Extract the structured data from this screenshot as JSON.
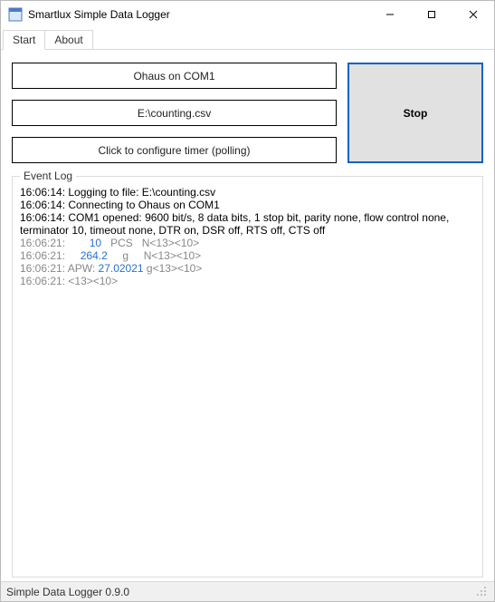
{
  "window": {
    "title": "Smartlux Simple Data Logger"
  },
  "tabs": {
    "start": "Start",
    "about": "About"
  },
  "buttons": {
    "device": "Ohaus on COM1",
    "file": "E:\\counting.csv",
    "timer": "Click to configure timer (polling)",
    "stop": "Stop"
  },
  "log": {
    "legend": "Event Log",
    "lines": [
      {
        "t": "16:06:14:",
        "rest": " Logging to file: E:\\counting.csv"
      },
      {
        "t": "16:06:14:",
        "rest": " Connecting to Ohaus on COM1"
      },
      {
        "t": "16:06:14:",
        "rest": " COM1 opened: 9600 bit/s, 8 data bits, 1 stop bit, parity none, flow control none, terminator 10, timeout none, DTR on, DSR off, RTS off, CTS off"
      },
      {
        "gray": true,
        "t": "16:06:21:",
        "val": "        10",
        "rest": "   PCS   N<13><10>"
      },
      {
        "gray": true,
        "t": "16:06:21:",
        "val": "     264.2",
        "rest": "     g     N<13><10>"
      },
      {
        "gray": true,
        "t": "16:06:21:",
        "pre": " APW: ",
        "val": "27.02021",
        "rest": " g<13><10>"
      },
      {
        "gray": true,
        "t": "16:06:21:",
        "rest": " <13><10>"
      }
    ]
  },
  "status": {
    "text": "Simple Data Logger 0.9.0"
  }
}
